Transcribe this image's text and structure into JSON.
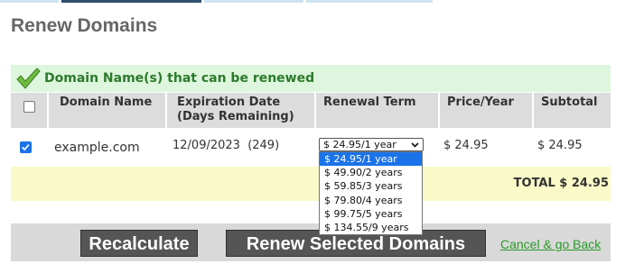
{
  "colors": {
    "accent": "#1a73e8",
    "banner_bg": "#ddf6dd",
    "banner_text": "#2c7a2c",
    "total_bg": "#fafac8",
    "button_bg": "#555555",
    "link": "#2a9a2a"
  },
  "page": {
    "title": "Renew Domains"
  },
  "banner": {
    "icon": "checkmark-icon",
    "text": "Domain Name(s) that can be renewed"
  },
  "table": {
    "headers": {
      "domain": "Domain Name",
      "expiration": [
        "Expiration Date",
        "(Days Remaining)"
      ],
      "term": "Renewal Term",
      "price": "Price/Year",
      "subtotal": "Subtotal"
    },
    "select_all_checked": false,
    "rows": [
      {
        "checked": true,
        "domain": "example.com",
        "expiration": "12/09/2023  (249)",
        "term_selected": "$ 24.95/1 year",
        "price": "$ 24.95",
        "subtotal": "$ 24.95"
      }
    ]
  },
  "term_options": [
    "$ 24.95/1 year",
    "$ 49.90/2 years",
    "$ 59.85/3 years",
    "$ 79.80/4 years",
    "$ 99.75/5 years",
    "$ 134.55/9 years"
  ],
  "total": "TOTAL $ 24.95",
  "actions": {
    "recalculate": "Recalculate",
    "renew": "Renew Selected Domains",
    "cancel": "Cancel & go Back"
  }
}
